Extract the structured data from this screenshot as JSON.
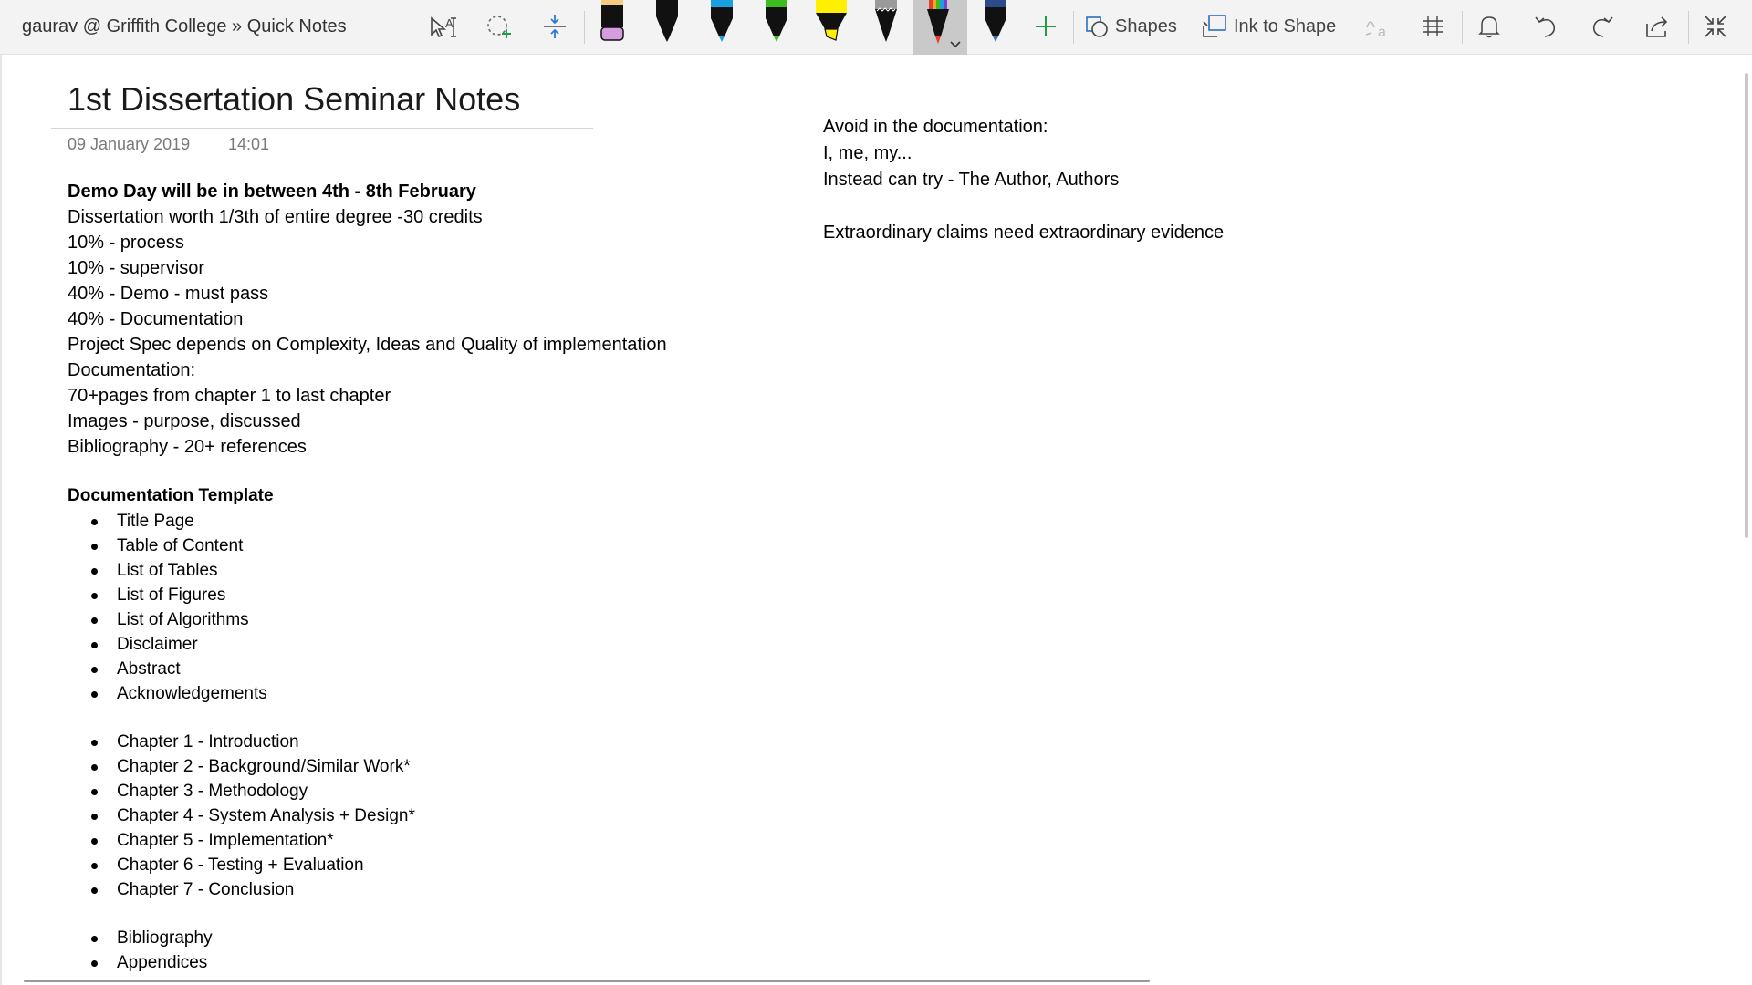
{
  "toolbar": {
    "breadcrumb": "gaurav @ Griffith College » Quick Notes",
    "shapes_label": "Shapes",
    "ink_to_shape_label": "Ink to Shape",
    "pens": [
      {
        "name": "pen-pink",
        "color": "#d79be0"
      },
      {
        "name": "pen-black",
        "color": "#000000"
      },
      {
        "name": "pen-cyan",
        "color": "#1aa0e0"
      },
      {
        "name": "pen-green",
        "color": "#3dbb1f"
      },
      {
        "name": "highlighter-yellow",
        "color": "#ffef00"
      },
      {
        "name": "pen-gray",
        "color": "#9a9a9a"
      },
      {
        "name": "pen-rainbow",
        "color": "#e23d2f"
      },
      {
        "name": "pen-galaxy",
        "color": "#2a4a8a"
      }
    ],
    "accent_add_color": "#1e9e43"
  },
  "page": {
    "title": "1st Dissertation Seminar Notes",
    "date": "09 January 2019",
    "time": "14:01"
  },
  "notes": {
    "heading": "Demo Day will be in between 4th - 8th February",
    "lines": [
      "Dissertation worth 1/3th of entire degree -30 credits",
      "10% - process",
      "10% - supervisor",
      "40% - Demo - must pass",
      "40% - Documentation",
      "Project Spec depends on Complexity, Ideas and Quality of implementation",
      "Documentation:",
      "70+pages from chapter 1 to last chapter",
      "Images - purpose, discussed",
      "Bibliography - 20+ references"
    ]
  },
  "template": {
    "title": "Documentation Template",
    "front_matter": [
      "Title Page",
      "Table of  Content",
      "List of Tables",
      "List of Figures",
      "List of Algorithms",
      "Disclaimer",
      "Abstract",
      "Acknowledgements"
    ],
    "chapters": [
      "Chapter 1 - Introduction",
      "Chapter 2 - Background/Similar Work*",
      "Chapter 3 - Methodology",
      "Chapter 4 - System Analysis + Design*",
      "Chapter 5 - Implementation*",
      "Chapter 6 - Testing + Evaluation",
      "Chapter 7 - Conclusion"
    ],
    "back_matter": [
      "Bibliography",
      "Appendices"
    ]
  },
  "right_notes": {
    "lines": [
      "Avoid in the documentation:",
      "I, me, my...",
      "Instead can try - The Author, Authors"
    ],
    "quote": "Extraordinary claims need extraordinary evidence"
  }
}
